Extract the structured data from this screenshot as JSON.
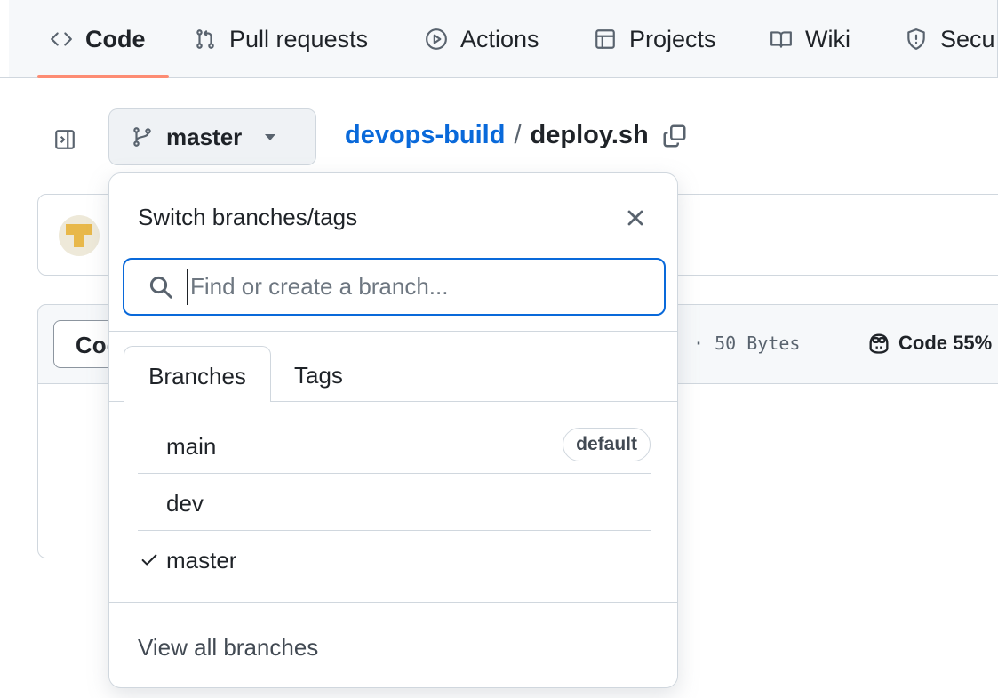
{
  "nav": {
    "tabs": [
      {
        "label": "Code",
        "icon": "code-icon"
      },
      {
        "label": "Pull requests",
        "icon": "pull-request-icon"
      },
      {
        "label": "Actions",
        "icon": "play-icon"
      },
      {
        "label": "Projects",
        "icon": "table-icon"
      },
      {
        "label": "Wiki",
        "icon": "book-icon"
      },
      {
        "label": "Secu",
        "icon": "shield-icon"
      }
    ],
    "active": "Code"
  },
  "toolbar": {
    "branch": "master",
    "repo": "devops-build",
    "separator": "/",
    "file": "deploy.sh"
  },
  "file_header": {
    "code_button": "Code",
    "meta": "· 50 Bytes",
    "code_stat": "Code 55%"
  },
  "dropdown": {
    "title": "Switch branches/tags",
    "search_placeholder": "Find or create a branch...",
    "tabs": [
      "Branches",
      "Tags"
    ],
    "active_tab": "Branches",
    "branches": [
      {
        "name": "main",
        "badge": "default",
        "selected": false
      },
      {
        "name": "dev",
        "badge": "",
        "selected": false
      },
      {
        "name": "master",
        "badge": "",
        "selected": true
      }
    ],
    "footer": "View all branches"
  },
  "colors": {
    "accent_blue": "#0969da",
    "active_underline": "#fd8c73",
    "border": "#d0d7de"
  }
}
